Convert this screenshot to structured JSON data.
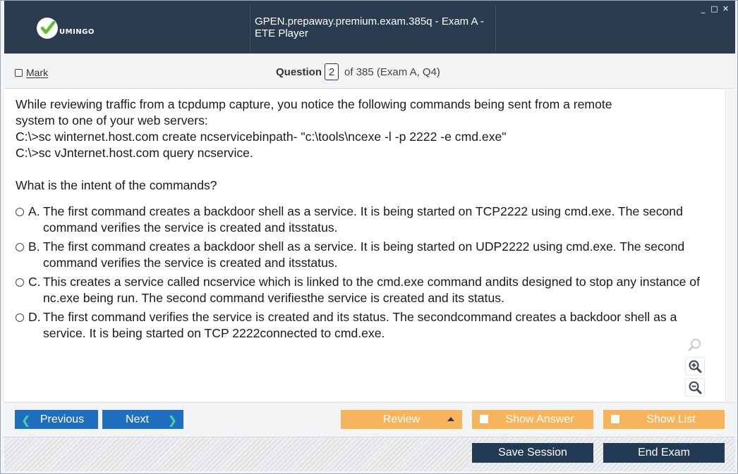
{
  "app": {
    "logo_text": "UMINGO",
    "window_title": "GPEN.prepaway.premium.exam.385q - Exam A - ETE Player",
    "controls": {
      "minimize": "_",
      "maximize": "□",
      "close": "✕"
    }
  },
  "question_bar": {
    "mark_label": "Mark",
    "question_word": "Question",
    "question_number": "2",
    "of_text": "of 385 (Exam A, Q4)"
  },
  "question": {
    "stem_lines": [
      "While reviewing traffic from a tcpdump capture, you notice the following commands being sent from a remote",
      "system to one of your web servers:",
      "C:\\>sc winternet.host.com create ncservicebinpath- \"c:\\tools\\ncexe -l -p 2222 -e cmd.exe\"",
      "C:\\>sc vJnternet.host.com query ncservice."
    ],
    "prompt": "What is the intent of the commands?",
    "options": [
      {
        "letter": "A.",
        "text": "The first command creates a backdoor shell as a service. It is being started on TCP2222 using cmd.exe. The second command verifies the service is created and itsstatus."
      },
      {
        "letter": "B.",
        "text": "The first command creates a backdoor shell as a service. It is being started on UDP2222 using cmd.exe. The second command verifies the service is created and itsstatus."
      },
      {
        "letter": "C.",
        "text": "This creates a service called ncservice which is linked to the cmd.exe command andits designed to stop any instance of nc.exe being run. The second command verifiesthe service is created and its status."
      },
      {
        "letter": "D.",
        "text": "The first command verifies the service is created and its status. The secondcommand creates a backdoor shell as a service. It is being started on TCP 2222connected to cmd.exe."
      }
    ]
  },
  "toolbar": {
    "previous_label": "Previous",
    "next_label": "Next",
    "review_label": "Review",
    "show_answer_label": "Show Answer",
    "show_list_label": "Show List"
  },
  "footer": {
    "save_session_label": "Save Session",
    "end_exam_label": "End Exam"
  },
  "colors": {
    "titlebar": "#2b3c50",
    "nav_button": "#1f6fc1",
    "orange_button": "#f7b45a",
    "footer_button": "#233a55",
    "logo_check": "#5fbf2a"
  },
  "icons": {
    "logo": "checkmark-logo-icon",
    "search": "magnifier-icon",
    "zoom_in": "zoom-in-icon",
    "zoom_out": "zoom-out-icon"
  }
}
